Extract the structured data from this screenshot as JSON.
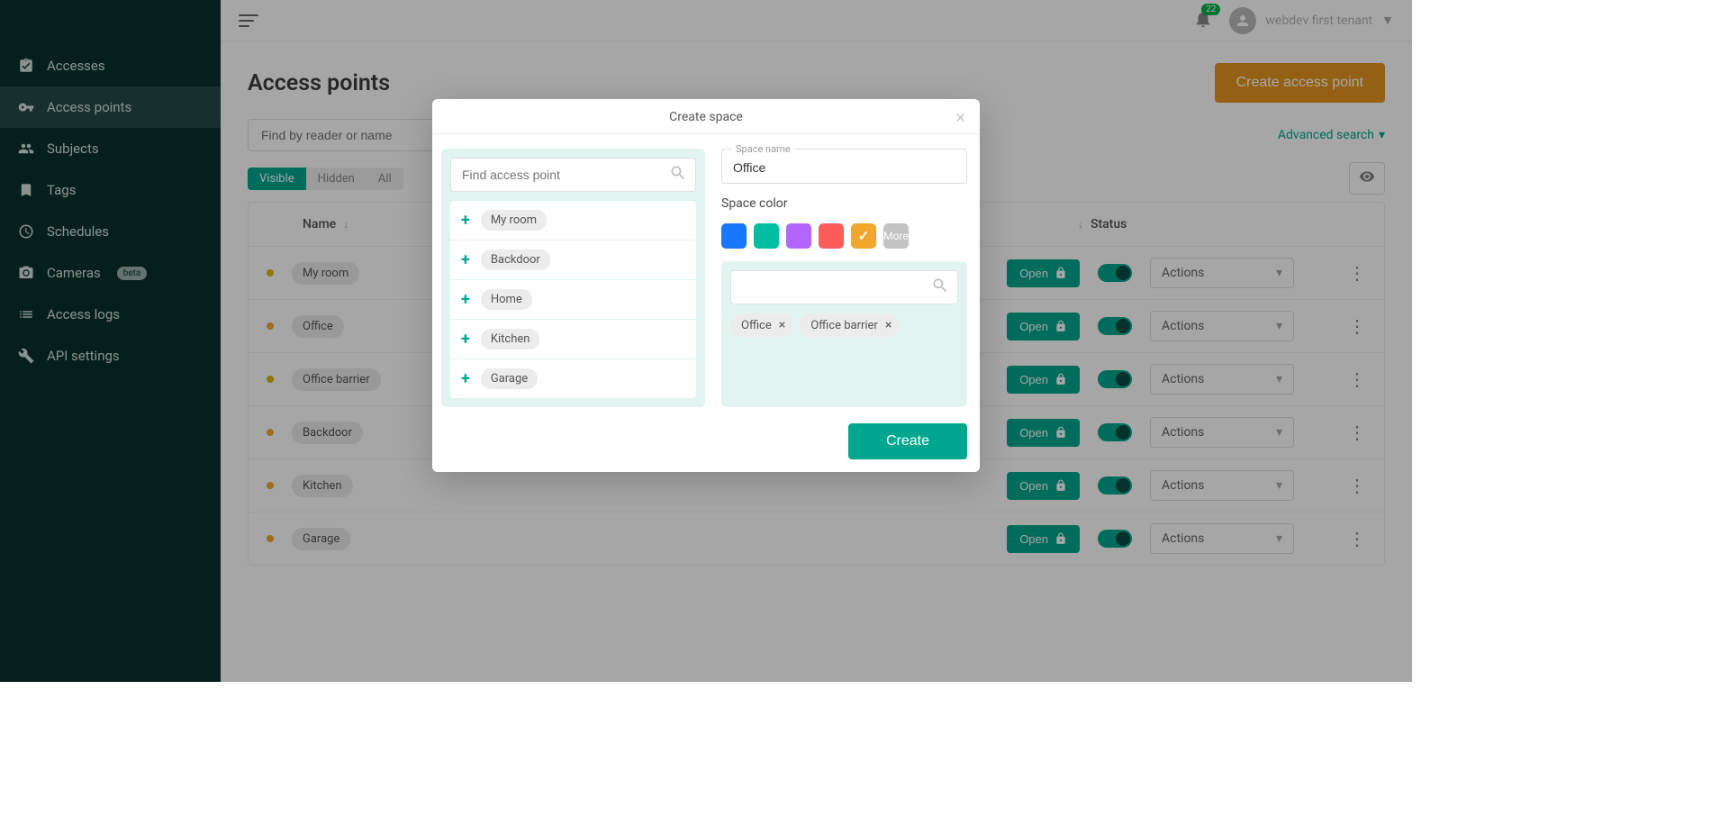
{
  "sidebar": {
    "items": [
      {
        "label": "Accesses",
        "icon": "clipboard"
      },
      {
        "label": "Access points",
        "icon": "key"
      },
      {
        "label": "Subjects",
        "icon": "people"
      },
      {
        "label": "Tags",
        "icon": "tag"
      },
      {
        "label": "Schedules",
        "icon": "clock"
      },
      {
        "label": "Cameras",
        "icon": "camera",
        "badge": "beta"
      },
      {
        "label": "Access logs",
        "icon": "list"
      },
      {
        "label": "API settings",
        "icon": "wrench"
      }
    ]
  },
  "topbar": {
    "notif_count": "22",
    "username": "webdev first tenant"
  },
  "page": {
    "title": "Access points",
    "create_button": "Create access point",
    "search_placeholder": "Find by reader or name",
    "advanced_search": "Advanced search",
    "tabs": [
      "Visible",
      "Hidden",
      "All"
    ],
    "col_name": "Name",
    "col_status": "Status",
    "open_label": "Open",
    "actions_label": "Actions",
    "rows": [
      {
        "name": "My room",
        "dot": "y"
      },
      {
        "name": "Office",
        "dot": "o"
      },
      {
        "name": "Office barrier",
        "dot": "y"
      },
      {
        "name": "Backdoor",
        "dot": "o"
      },
      {
        "name": "Kitchen",
        "dot": "o"
      },
      {
        "name": "Garage",
        "dot": "o"
      }
    ]
  },
  "modal": {
    "title": "Create space",
    "find_placeholder": "Find access point",
    "access_points": [
      "My room",
      "Backdoor",
      "Home",
      "Kitchen",
      "Garage"
    ],
    "space_name_label": "Space name",
    "space_name_value": "Office",
    "space_color_label": "Space color",
    "colors": [
      {
        "hex": "#1976ff",
        "selected": false
      },
      {
        "hex": "#00bfa0",
        "selected": false
      },
      {
        "hex": "#b266ff",
        "selected": false
      },
      {
        "hex": "#ff5c5c",
        "selected": false
      },
      {
        "hex": "#f3a62e",
        "selected": true
      }
    ],
    "more_label": "More",
    "selected": [
      "Office",
      "Office barrier"
    ],
    "create_label": "Create"
  }
}
